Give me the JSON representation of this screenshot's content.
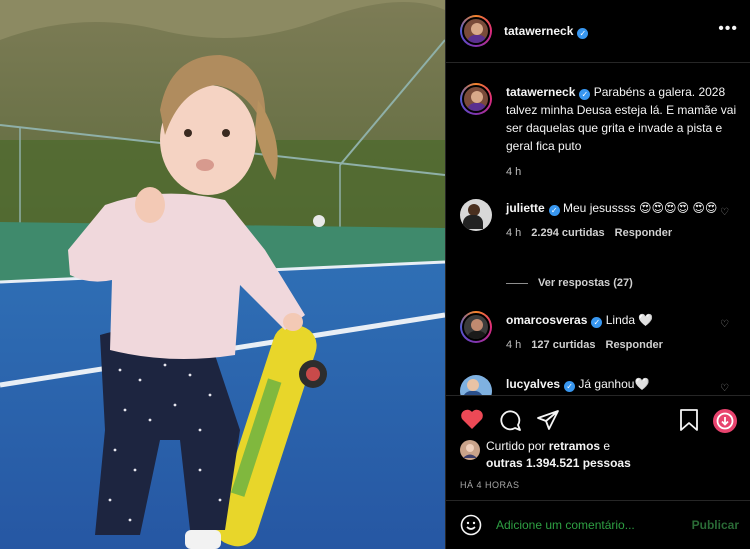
{
  "post": {
    "author": "tatawerneck",
    "caption": "Parabéns a galera. 2028 talvez minha Deusa esteja lá. E mamãe vai ser daquelas que grita e invade a pista e geral fica puto",
    "caption_age": "4 h"
  },
  "header": {
    "username": "tatawerneck",
    "more_label": "•••"
  },
  "comments": [
    {
      "username": "juliette",
      "text": "Meu jesussss 😍😍😍😍 😍😍",
      "age": "4 h",
      "likes": "2.294 curtidas",
      "reply_label": "Responder",
      "view_replies": "Ver respostas (27)"
    },
    {
      "username": "omarcosveras",
      "text": "Linda 🤍",
      "age": "4 h",
      "likes": "127 curtidas",
      "reply_label": "Responder"
    },
    {
      "username": "lucyalves",
      "text": "Já ganhou🤍"
    }
  ],
  "likes_section": {
    "liked_by_prefix": "Curtido por",
    "liked_by_user": "retramos",
    "and_label": "e",
    "others": "outras 1.394.521 pessoas",
    "posted_time": "HÁ 4 HORAS"
  },
  "add_comment": {
    "placeholder": "Adicione um comentário...",
    "post_label": "Publicar"
  },
  "colors": {
    "verified": "#3897f0",
    "like_red": "#ed4956",
    "comment_placeholder": "#2ea043"
  },
  "icons": {
    "like": "heart-icon",
    "comment": "comment-icon",
    "share": "send-icon",
    "save": "bookmark-icon",
    "download": "download-icon",
    "emoji": "emoji-icon",
    "verified": "verified-icon"
  }
}
